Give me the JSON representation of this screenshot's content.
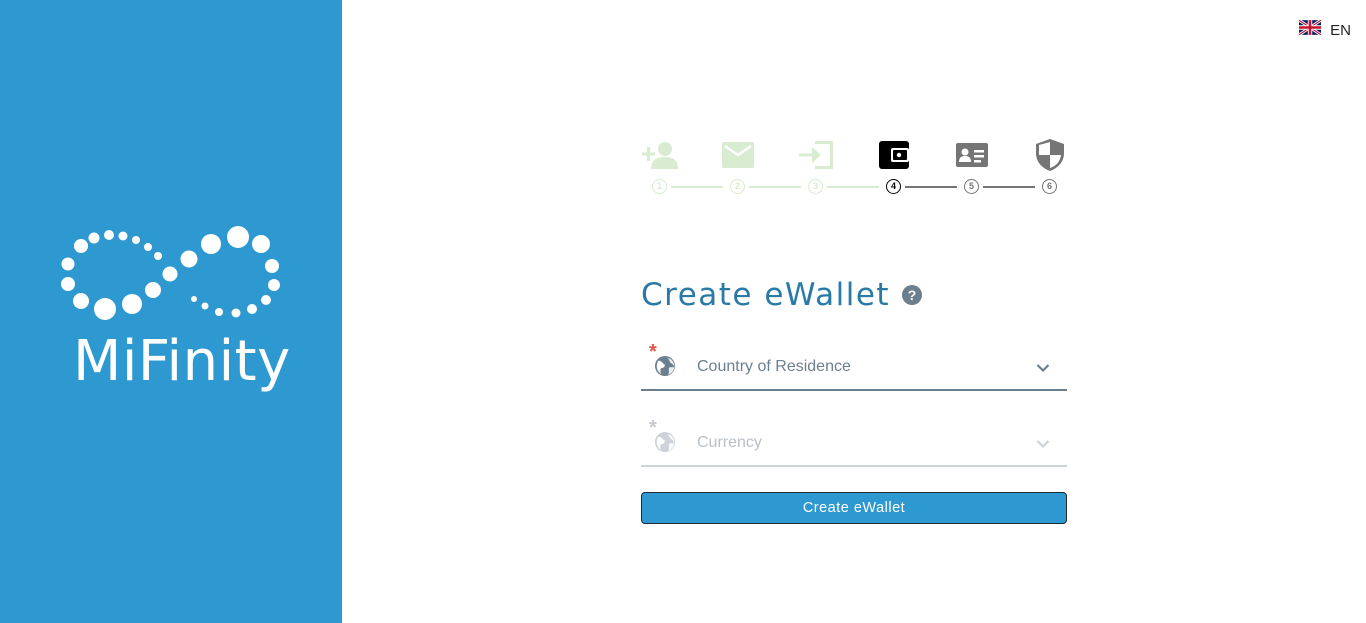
{
  "brand": {
    "name": "MiFinity"
  },
  "language": {
    "code": "EN",
    "flag_icon": "uk-flag-icon"
  },
  "stepper": {
    "steps": [
      {
        "number": "1",
        "icon": "add-user-icon",
        "state": "completed"
      },
      {
        "number": "2",
        "icon": "email-icon",
        "state": "completed"
      },
      {
        "number": "3",
        "icon": "login-icon",
        "state": "completed"
      },
      {
        "number": "4",
        "icon": "wallet-icon",
        "state": "active"
      },
      {
        "number": "5",
        "icon": "id-card-icon",
        "state": "pending"
      },
      {
        "number": "6",
        "icon": "shield-icon",
        "state": "pending"
      }
    ],
    "colors": {
      "completed": "#d7ecd0",
      "active": "#000000",
      "pending": "#757575"
    }
  },
  "form": {
    "title": "Create eWallet",
    "help": "?",
    "fields": [
      {
        "label": "Country of Residence",
        "required_mark": "*",
        "icon": "globe-icon",
        "enabled": true
      },
      {
        "label": "Currency",
        "required_mark": "*",
        "icon": "globe-icon",
        "enabled": false
      }
    ],
    "submit_label": "Create eWallet"
  },
  "colors": {
    "brand": "#2e98d0",
    "title": "#2a7aa8",
    "required": "#e05545"
  }
}
